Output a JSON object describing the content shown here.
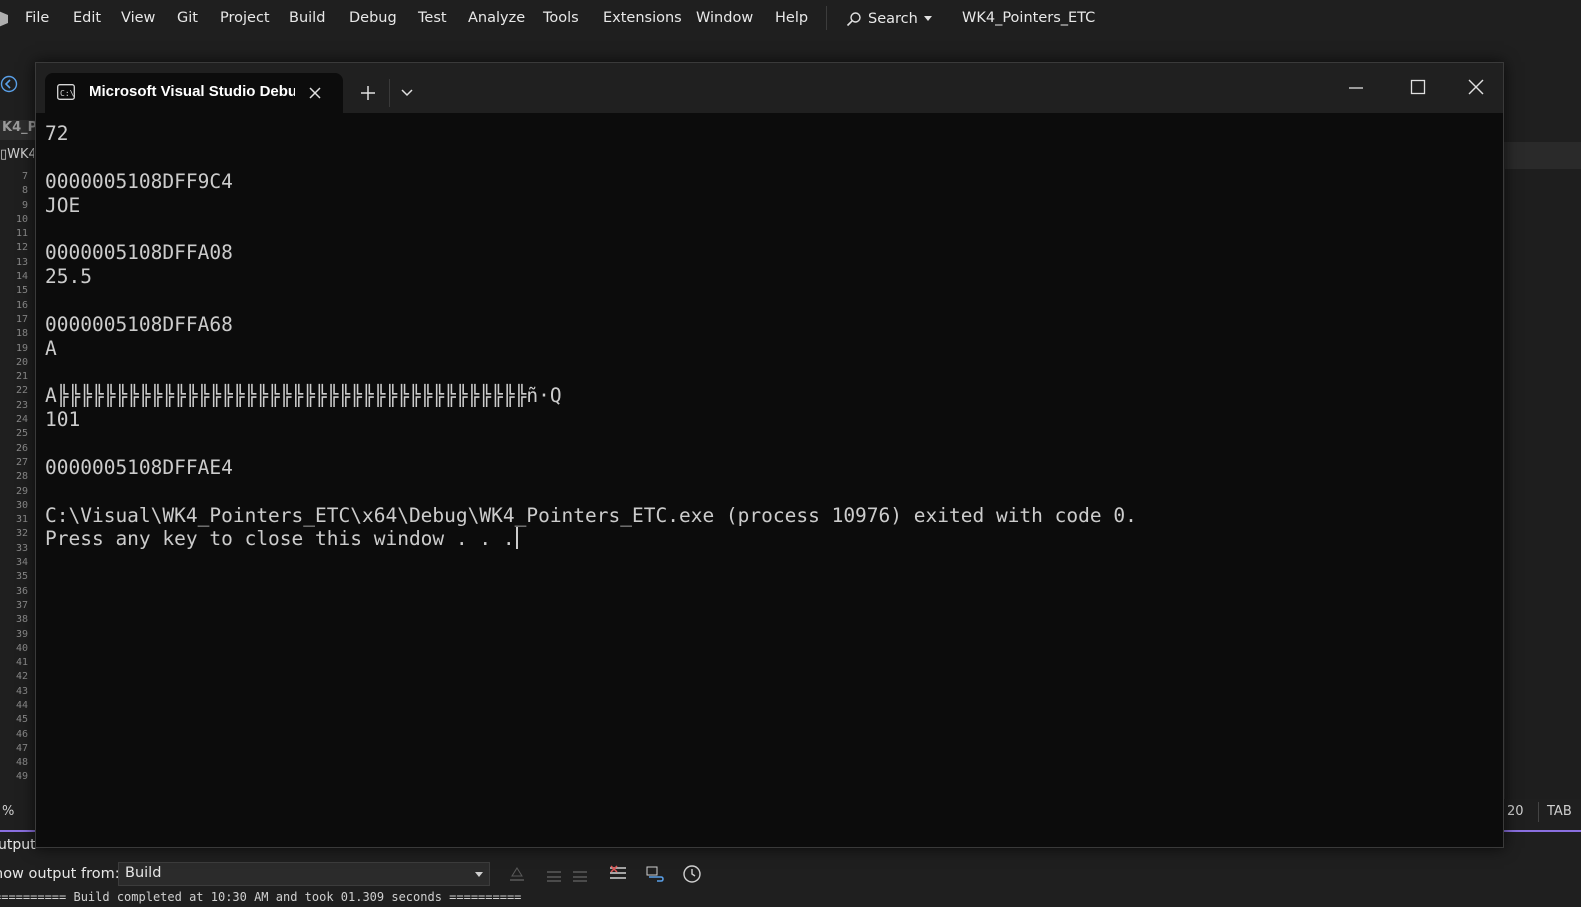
{
  "menubar": {
    "items": [
      "File",
      "Edit",
      "View",
      "Git",
      "Project",
      "Build",
      "Debug",
      "Test",
      "Analyze",
      "Tools",
      "Extensions",
      "Window",
      "Help"
    ],
    "search_label": "Search",
    "solution_name": "WK4_Pointers_ETC"
  },
  "editor": {
    "tab_sliver_1": "K4_P",
    "tab_sliver_2": "WK4",
    "line_numbers": [
      "7",
      "8",
      "9",
      "10",
      "11",
      "12",
      "13",
      "14",
      "15",
      "16",
      "17",
      "18",
      "19",
      "20",
      "21",
      "22",
      "23",
      "24",
      "25",
      "26",
      "27",
      "28",
      "29",
      "30",
      "31",
      "32",
      "33",
      "34",
      "35",
      "36",
      "37",
      "38",
      "39",
      "40",
      "41",
      "42",
      "43",
      "44",
      "45",
      "46",
      "47",
      "48",
      "49"
    ],
    "zoom_sliver": "%"
  },
  "status": {
    "line": "20",
    "indent_mode": "TAB"
  },
  "output": {
    "title": "utput",
    "show_from_label": "how output from:",
    "source": "Build",
    "text": "========== Build completed at 10:30 AM and took 01.309 seconds =========="
  },
  "terminal": {
    "tab_title": "Microsoft Visual Studio Debug Console",
    "lines": [
      "72",
      "",
      "0000005108DFF9C4",
      "JOE",
      "",
      "0000005108DFFA08",
      "25.5",
      "",
      "0000005108DFFA68",
      "A",
      "",
      "A╠╠╠╠╠╠╠╠╠╠╠╠╠╠╠╠╠╠╠╠╠╠╠╠╠╠╠╠╠╠╠╠╠╠╠╠╠╠╠╠ñ·Q",
      "101",
      "",
      "0000005108DFFAE4",
      "",
      "C:\\Visual\\WK4_Pointers_ETC\\x64\\Debug\\WK4_Pointers_ETC.exe (process 10976) exited with code 0.",
      "Press any key to close this window . . ."
    ]
  }
}
